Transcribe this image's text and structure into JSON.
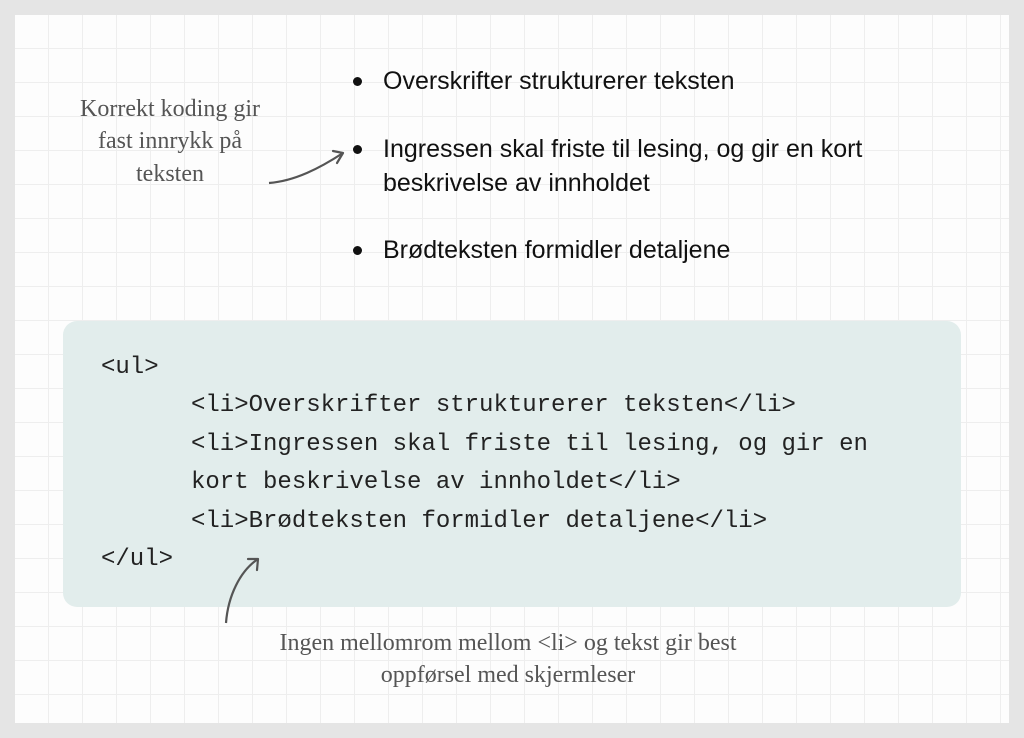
{
  "annotations": {
    "top": "Korrekt koding gir fast innrykk på teksten",
    "bottom": "Ingen mellomrom mellom <li> og tekst gir best oppførsel med skjermleser"
  },
  "bullets": [
    "Overskrifter strukturerer teksten",
    "Ingressen skal friste til lesing, og gir en kort beskrivelse av innholdet",
    "Brødteksten formidler detaljene"
  ],
  "code": {
    "open": "<ul>",
    "line1": "<li>Overskrifter strukturerer teksten</li>",
    "line2": "<li>Ingressen skal friste til lesing, og gir en kort beskrivelse av innholdet</li>",
    "line3": "<li>Brødteksten formidler detaljene</li>",
    "close": "</ul>"
  }
}
